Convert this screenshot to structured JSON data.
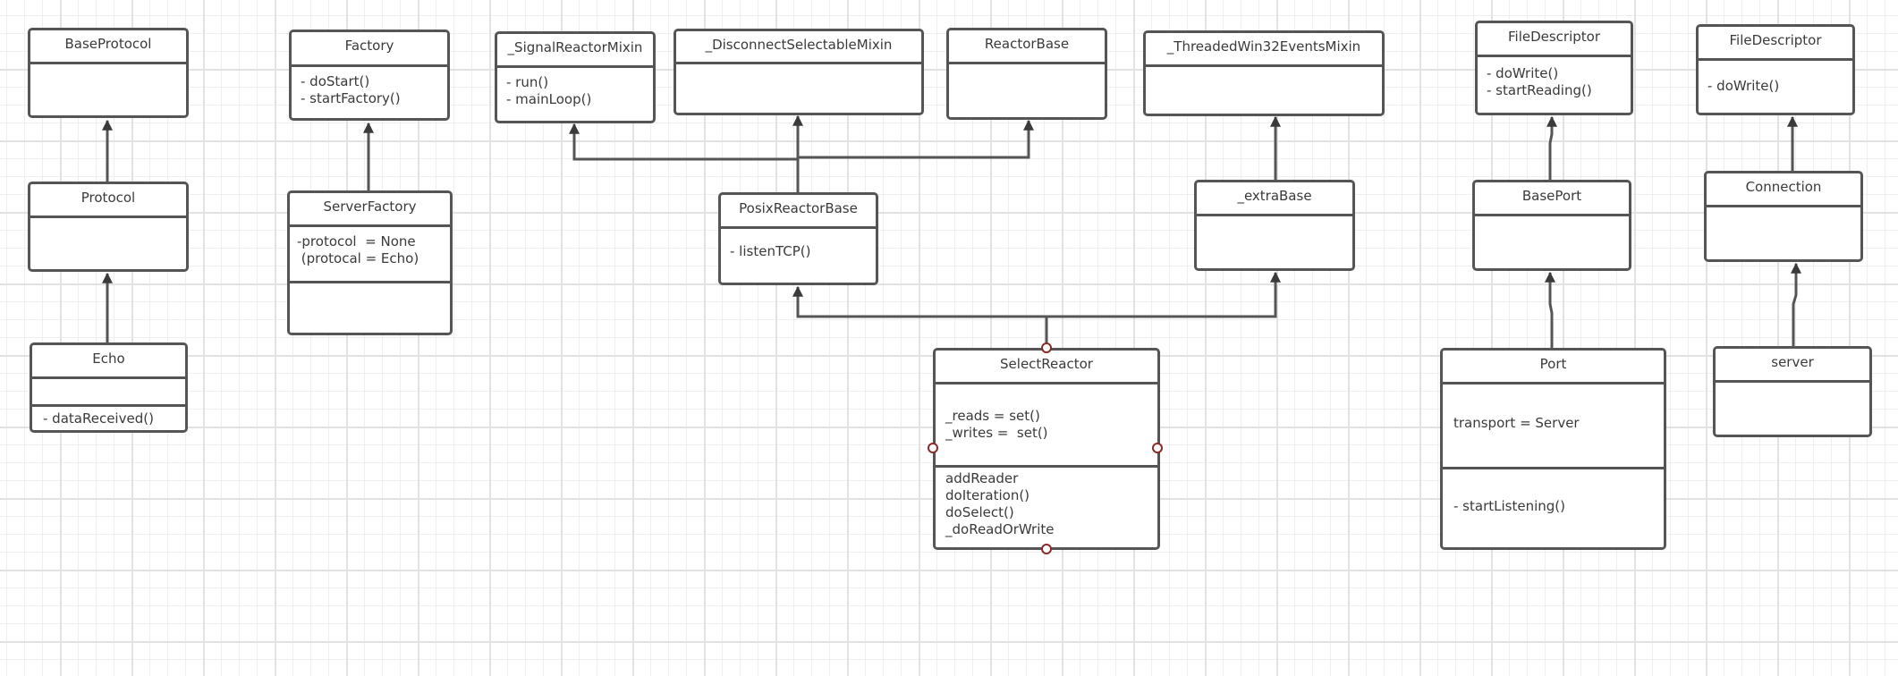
{
  "diagram": {
    "type": "UML class diagram",
    "classes": [
      {
        "id": "baseprotocol",
        "name": "BaseProtocol",
        "attributes": [],
        "methods": []
      },
      {
        "id": "protocol",
        "name": "Protocol",
        "attributes": [],
        "methods": []
      },
      {
        "id": "echo",
        "name": "Echo",
        "attributes": [],
        "methods": [
          "- dataReceived()"
        ]
      },
      {
        "id": "factory",
        "name": "Factory",
        "attributes": [
          "- doStart()",
          "- startFactory()"
        ],
        "methods": []
      },
      {
        "id": "serverfactory",
        "name": "ServerFactory",
        "attributes": [
          "-protocol  = None",
          " (protocal = Echo)"
        ],
        "methods": []
      },
      {
        "id": "signalreactormixin",
        "name": "_SignalReactorMixin",
        "attributes": [
          "- run()",
          "- mainLoop()"
        ],
        "methods": []
      },
      {
        "id": "disconnectselectablemixin",
        "name": "_DisconnectSelectableMixin",
        "attributes": [],
        "methods": []
      },
      {
        "id": "reactorbase",
        "name": "ReactorBase",
        "attributes": [],
        "methods": []
      },
      {
        "id": "threadedwin32eventsmixin",
        "name": "_ThreadedWin32EventsMixin",
        "attributes": [],
        "methods": []
      },
      {
        "id": "posixreactorbase",
        "name": "PosixReactorBase",
        "attributes": [
          "- listenTCP()"
        ],
        "methods": []
      },
      {
        "id": "extrabase",
        "name": "_extraBase",
        "attributes": [],
        "methods": []
      },
      {
        "id": "selectreactor",
        "name": "SelectReactor",
        "attributes": [
          "_reads = set()",
          "_writes =  set()"
        ],
        "methods": [
          "addReader",
          "doIteration()",
          "doSelect()",
          "_doReadOrWrite"
        ]
      },
      {
        "id": "filedescriptor1",
        "name": "FileDescriptor",
        "attributes": [
          "- doWrite()",
          "- startReading()"
        ],
        "methods": []
      },
      {
        "id": "baseport",
        "name": "BasePort",
        "attributes": [],
        "methods": []
      },
      {
        "id": "port",
        "name": "Port",
        "attributes": [
          "transport = Server"
        ],
        "methods": [
          "- startListening()"
        ]
      },
      {
        "id": "filedescriptor2",
        "name": "FileDescriptor",
        "attributes": [
          "- doWrite()"
        ],
        "methods": []
      },
      {
        "id": "connection",
        "name": "Connection",
        "attributes": [],
        "methods": []
      },
      {
        "id": "server",
        "name": "server",
        "attributes": [],
        "methods": []
      }
    ],
    "inheritance": [
      {
        "child": "protocol",
        "parent": "baseprotocol"
      },
      {
        "child": "echo",
        "parent": "protocol"
      },
      {
        "child": "serverfactory",
        "parent": "factory"
      },
      {
        "child": "posixreactorbase",
        "parent": "signalreactormixin"
      },
      {
        "child": "posixreactorbase",
        "parent": "disconnectselectablemixin"
      },
      {
        "child": "posixreactorbase",
        "parent": "reactorbase"
      },
      {
        "child": "extrabase",
        "parent": "threadedwin32eventsmixin"
      },
      {
        "child": "selectreactor",
        "parent": "posixreactorbase"
      },
      {
        "child": "selectreactor",
        "parent": "extrabase"
      },
      {
        "child": "baseport",
        "parent": "filedescriptor1"
      },
      {
        "child": "port",
        "parent": "baseport"
      },
      {
        "child": "connection",
        "parent": "filedescriptor2"
      },
      {
        "child": "server",
        "parent": "connection"
      }
    ],
    "colors": {
      "line": "#555555",
      "grid": "#e6e6e6",
      "port_handle": "#8a2a2a"
    }
  }
}
